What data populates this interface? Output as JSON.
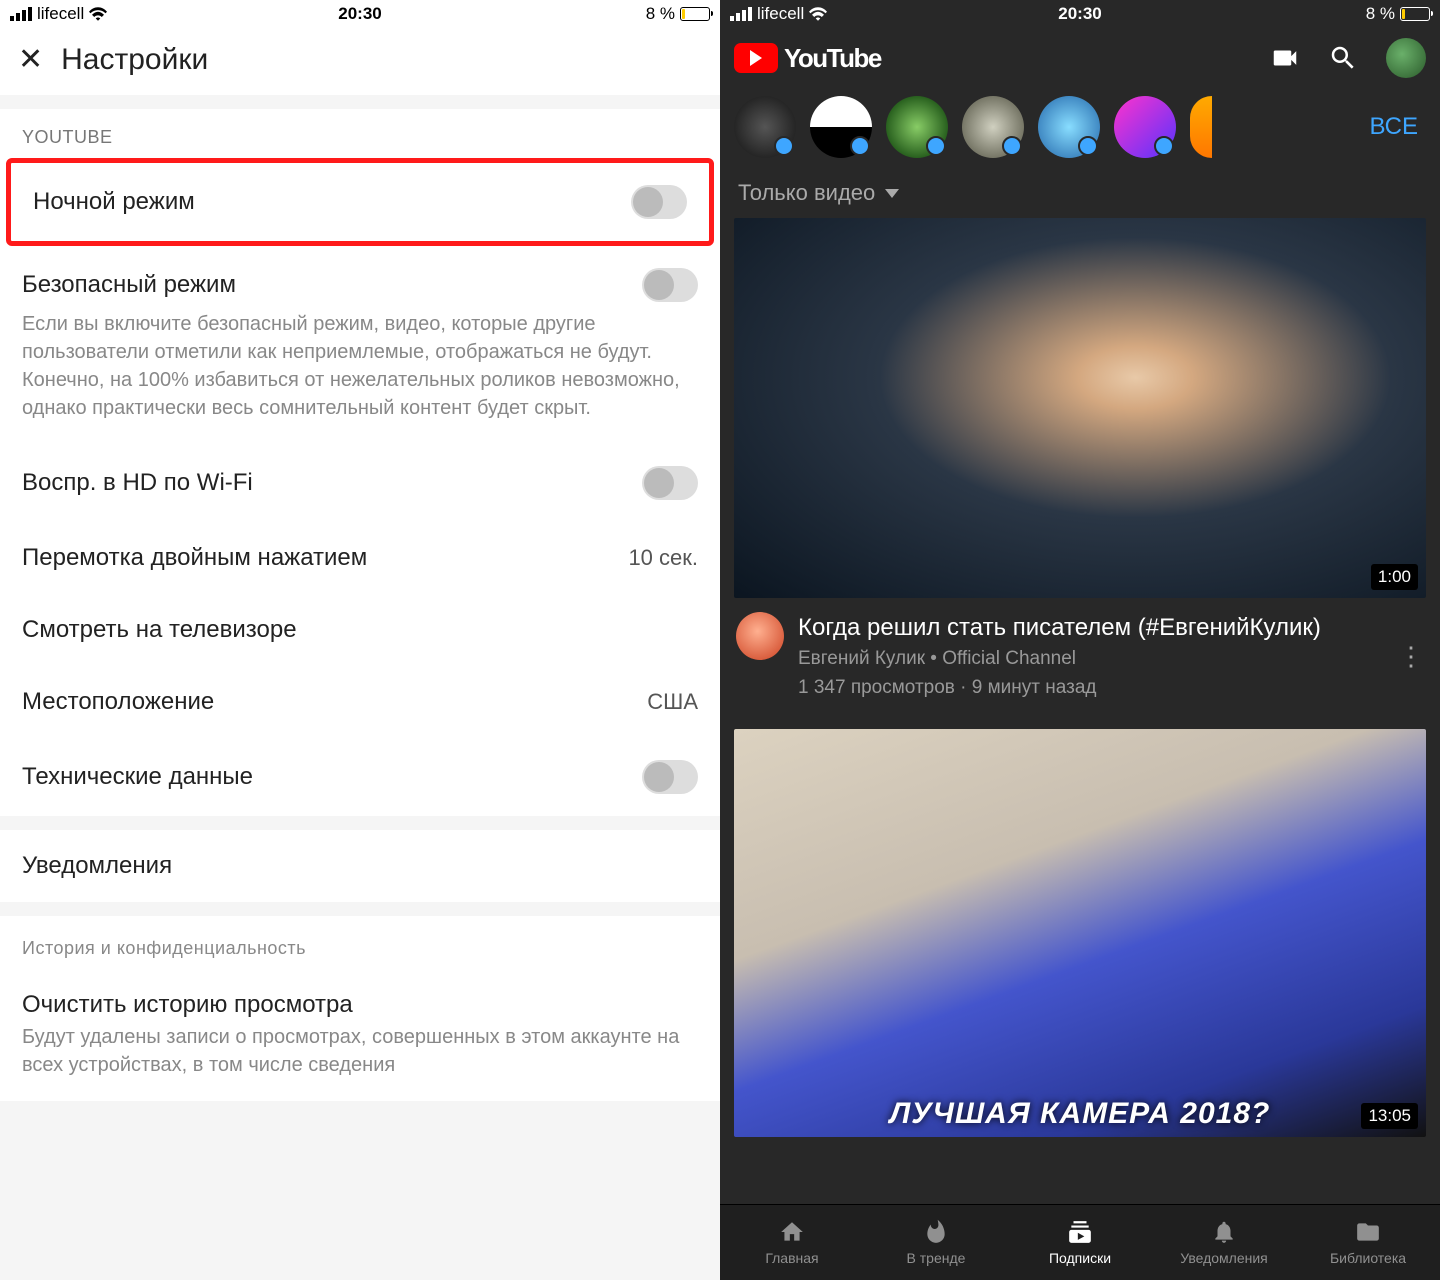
{
  "status": {
    "carrier": "lifecell",
    "time": "20:30",
    "battery": "8 %"
  },
  "left": {
    "title": "Настройки",
    "section_label": "YOUTUBE",
    "night_mode": "Ночной режим",
    "restricted": "Безопасный режим",
    "restricted_desc": "Если вы включите безопасный режим, видео, которые другие пользователи отметили как неприемлемые, отображаться не будут. Конечно, на 100% избавиться от нежелательных роликов невозможно, однако практически весь сомнительный контент будет скрыт.",
    "hd_wifi": "Воспр. в HD по Wi-Fi",
    "double_tap": "Перемотка двойным нажатием",
    "double_tap_value": "10 сек.",
    "tv": "Смотреть на телевизоре",
    "location": "Местоположение",
    "location_value": "США",
    "tech": "Технические данные",
    "notifications": "Уведомления",
    "history_section": "История и конфиденциальность",
    "clear_history": "Очистить историю просмотра",
    "clear_history_desc": "Будут удалены записи о просмотрах, совершенных в этом аккаунте на всех устройствах, в том числе сведения"
  },
  "right": {
    "brand": "YouTube",
    "all": "ВСЕ",
    "filter": "Только видео",
    "video1": {
      "duration": "1:00",
      "title": "Когда решил стать писателем (#ЕвгенийКулик)",
      "channel": "Евгений Кулик • Official Channel",
      "stats": "1 347 просмотров · 9 минут назад"
    },
    "video2": {
      "caption": "ЛУЧШАЯ КАМЕРА 2018?",
      "duration": "13:05"
    },
    "nav": {
      "home": "Главная",
      "trending": "В тренде",
      "subs": "Подписки",
      "notif": "Уведомления",
      "library": "Библиотека"
    }
  }
}
